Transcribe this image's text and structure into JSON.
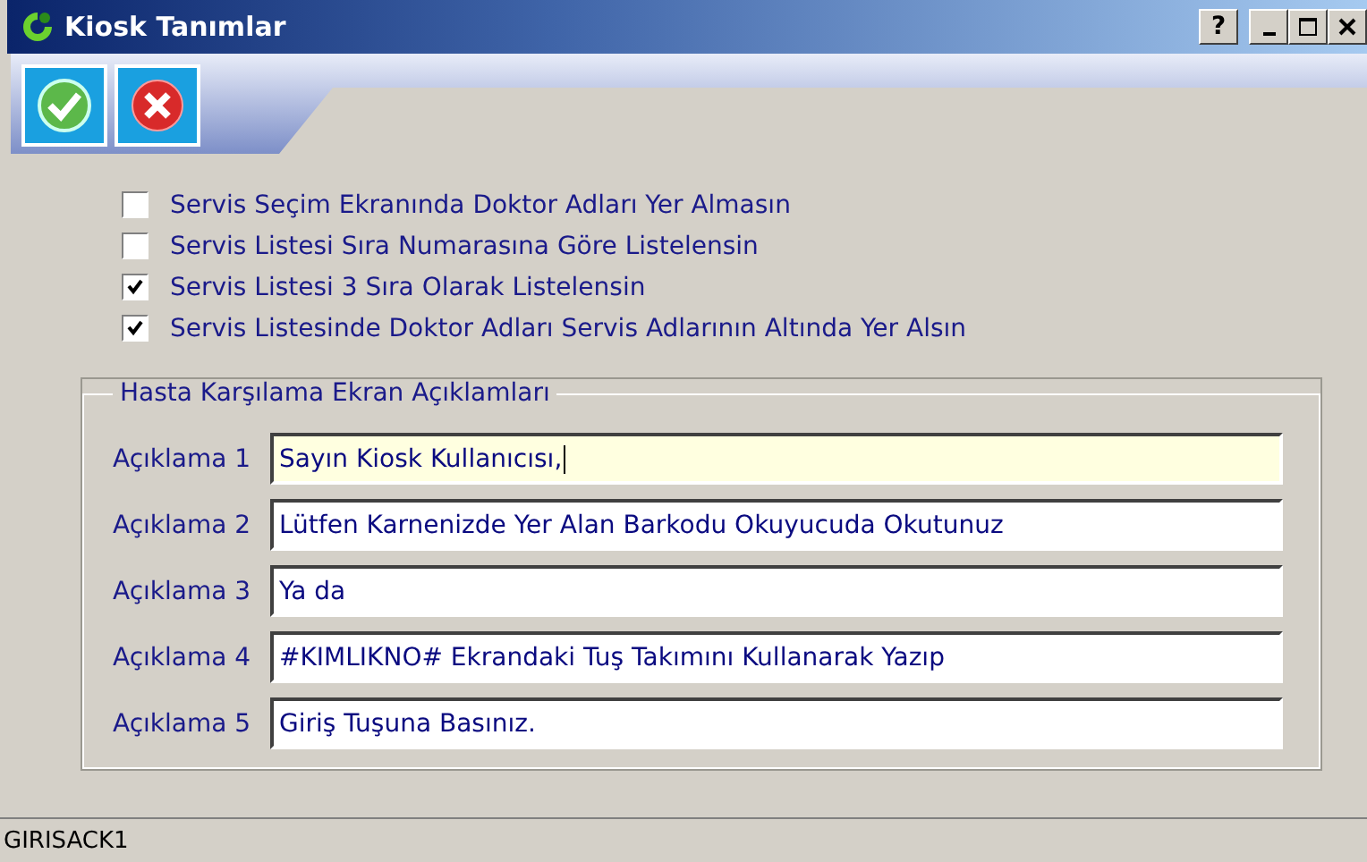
{
  "window": {
    "title": "Kiosk Tanımlar",
    "help_button": "?"
  },
  "options": [
    {
      "label": "Servis Seçim Ekranında Doktor Adları Yer Almasın",
      "checked": false
    },
    {
      "label": "Servis Listesi Sıra Numarasına Göre Listelensin",
      "checked": false
    },
    {
      "label": "Servis Listesi 3 Sıra Olarak Listelensin",
      "checked": true
    },
    {
      "label": "Servis Listesinde Doktor Adları Servis Adlarının Altında Yer Alsın",
      "checked": true
    }
  ],
  "group": {
    "title": "Hasta Karşılama Ekran Açıklamları",
    "fields": [
      {
        "label": "Açıklama 1",
        "value": "Sayın Kiosk Kullanıcısı,",
        "focused": true
      },
      {
        "label": "Açıklama 2",
        "value": "Lütfen Karnenizde Yer Alan Barkodu Okuyucuda Okutunuz",
        "focused": false
      },
      {
        "label": "Açıklama 3",
        "value": "Ya da",
        "focused": false
      },
      {
        "label": "Açıklama 4",
        "value": "#KIMLIKNO# Ekrandaki Tuş Takımını Kullanarak Yazıp",
        "focused": false
      },
      {
        "label": "Açıklama 5",
        "value": "Giriş Tuşuna Basınız.",
        "focused": false
      }
    ]
  },
  "status_bar": "GIRISACK1"
}
